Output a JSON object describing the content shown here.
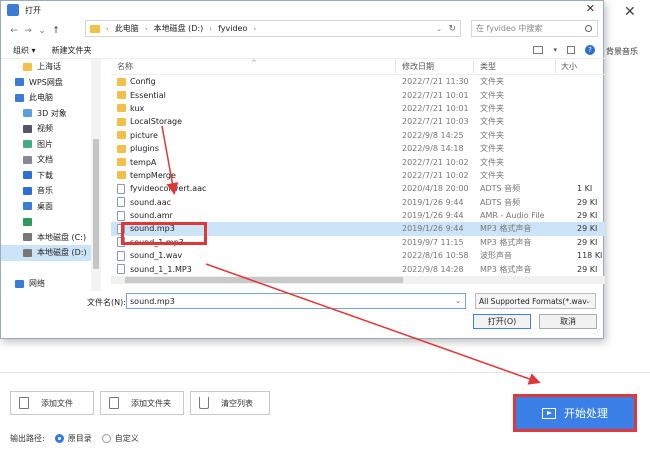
{
  "app": {
    "close_glyph": "✕",
    "bgm_label": "背景音乐",
    "buttons": {
      "add_file": "添加文件",
      "add_folder": "添加文件夹",
      "clear_list": "清空列表",
      "start": "开始处理"
    },
    "output": {
      "label": "输出路径:",
      "options": [
        "原目录",
        "自定义"
      ],
      "selected": "原目录"
    }
  },
  "dialog": {
    "title": "打开",
    "address": [
      "此电脑",
      "本地磁盘 (D:)",
      "fyvideo"
    ],
    "search_placeholder": "在 fyvideo 中搜索",
    "toolbar": {
      "organize": "组织 ▾",
      "new_folder": "新建文件夹"
    },
    "nav_items": [
      {
        "label": "上海话",
        "icon": "folder-icon",
        "indent": 1
      },
      {
        "label": "WPS网盘",
        "icon": "cloud-icon",
        "indent": 0
      },
      {
        "label": "此电脑",
        "icon": "computer-icon",
        "indent": 0
      },
      {
        "label": "3D 对象",
        "icon": "cube-icon",
        "indent": 1
      },
      {
        "label": "视频",
        "icon": "video-icon",
        "indent": 1
      },
      {
        "label": "图片",
        "icon": "picture-icon",
        "indent": 1
      },
      {
        "label": "文档",
        "icon": "document-icon",
        "indent": 1
      },
      {
        "label": "下载",
        "icon": "download-icon",
        "indent": 1
      },
      {
        "label": "音乐",
        "icon": "music-icon",
        "indent": 1
      },
      {
        "label": "桌面",
        "icon": "desktop-icon",
        "indent": 1
      },
      {
        "label": "",
        "icon": "app-icon",
        "indent": 1
      },
      {
        "label": "本地磁盘 (C:)",
        "icon": "drive-icon",
        "indent": 1
      },
      {
        "label": "本地磁盘 (D:)",
        "icon": "drive-icon",
        "indent": 1,
        "selected": true
      },
      {
        "label": "",
        "icon": "",
        "indent": 0
      },
      {
        "label": "网络",
        "icon": "network-icon",
        "indent": 0
      }
    ],
    "columns": {
      "name": "名称",
      "date": "修改日期",
      "type": "类型",
      "size": "大小"
    },
    "files": [
      {
        "name": "Config",
        "date": "2022/7/21 11:30",
        "type": "文件夹",
        "size": "",
        "kind": "folder"
      },
      {
        "name": "Essential",
        "date": "2022/7/21 10:01",
        "type": "文件夹",
        "size": "",
        "kind": "folder"
      },
      {
        "name": "kux",
        "date": "2022/7/21 10:01",
        "type": "文件夹",
        "size": "",
        "kind": "folder"
      },
      {
        "name": "LocalStorage",
        "date": "2022/7/21 10:03",
        "type": "文件夹",
        "size": "",
        "kind": "folder"
      },
      {
        "name": "picture",
        "date": "2022/9/8 14:25",
        "type": "文件夹",
        "size": "",
        "kind": "folder"
      },
      {
        "name": "plugins",
        "date": "2022/9/8 14:18",
        "type": "文件夹",
        "size": "",
        "kind": "folder"
      },
      {
        "name": "tempA",
        "date": "2022/7/21 10:02",
        "type": "文件夹",
        "size": "",
        "kind": "folder"
      },
      {
        "name": "tempMerge",
        "date": "2022/7/21 10:02",
        "type": "文件夹",
        "size": "",
        "kind": "folder"
      },
      {
        "name": "fyvideoconvert.aac",
        "date": "2020/4/18 20:00",
        "type": "ADTS 音频",
        "size": "1 KI",
        "kind": "file"
      },
      {
        "name": "sound.aac",
        "date": "2019/1/26 9:44",
        "type": "ADTS 音频",
        "size": "29 KI",
        "kind": "file"
      },
      {
        "name": "sound.amr",
        "date": "2019/1/26 9:44",
        "type": "AMR - Audio File",
        "size": "29 KI",
        "kind": "file"
      },
      {
        "name": "sound.mp3",
        "date": "2019/1/26 9:44",
        "type": "MP3 格式声音",
        "size": "29 KI",
        "kind": "file",
        "selected": true
      },
      {
        "name": "sound_1.mp3",
        "date": "2019/9/7 11:15",
        "type": "MP3 格式声音",
        "size": "29 KI",
        "kind": "file"
      },
      {
        "name": "sound_1.wav",
        "date": "2022/8/16 10:58",
        "type": "波形声音",
        "size": "118 KI",
        "kind": "file"
      },
      {
        "name": "sound_1_1.MP3",
        "date": "2022/9/8 14:28",
        "type": "MP3 格式声音",
        "size": "29 KI",
        "kind": "file"
      }
    ],
    "filename_label": "文件名(N):",
    "filename_value": "sound.mp3",
    "filetype_value": "All Supported Formats(*.wav",
    "open_label": "打开(O)",
    "cancel_label": "取消"
  },
  "colors": {
    "accent": "#3b80e6",
    "highlight": "#e03838",
    "selection": "#cce4f7",
    "folder": "#f0c04b"
  }
}
